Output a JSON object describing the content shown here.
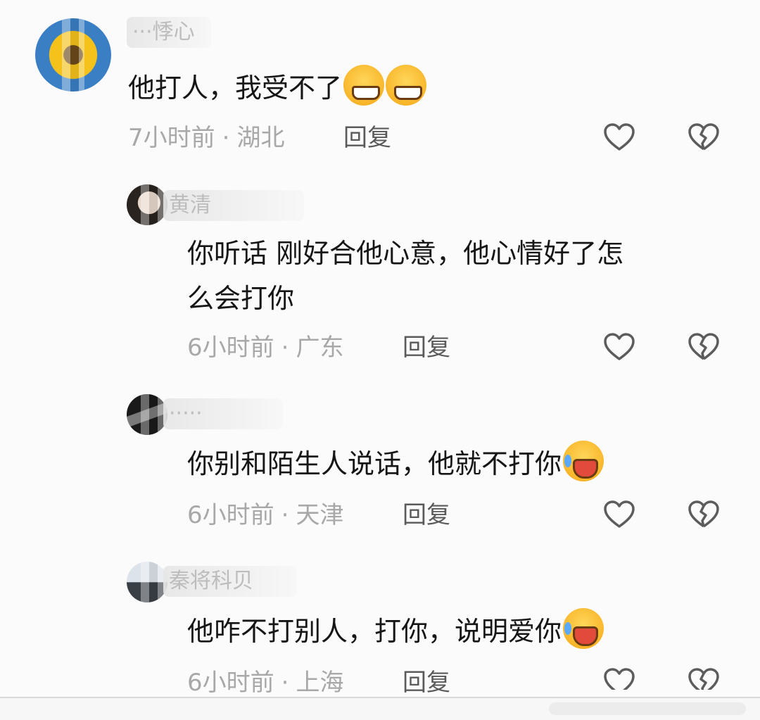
{
  "comments": [
    {
      "username": "···悸心",
      "text": "他打人，我受不了",
      "emoji": [
        "grin-sweat-icon",
        "grin-sweat-icon"
      ],
      "time": "7小时前",
      "region": "湖北",
      "reply_label": "回复"
    },
    {
      "username": "黄清",
      "text_line1": "你听话 刚好合他心意，他心情好了怎",
      "text_line2": "么会打你",
      "time": "6小时前",
      "region": "广东",
      "reply_label": "回复"
    },
    {
      "username": "·····",
      "text": "你别和陌生人说话，他就不打你",
      "emoji": [
        "laugh-cry-icon"
      ],
      "time": "6小时前",
      "region": "天津",
      "reply_label": "回复"
    },
    {
      "username": "秦将科贝",
      "text": "他咋不打别人，打你，说明爱你",
      "emoji": [
        "laugh-cry-icon"
      ],
      "time": "6小时前",
      "region": "上海",
      "reply_label": "回复"
    }
  ],
  "separator": "·",
  "colors": {
    "background": "#fbfbfb",
    "text": "#161616",
    "meta": "#a8a8a8",
    "reply": "#5a5a5a",
    "icon": "#5c5c5c"
  },
  "icons": [
    "heart-outline-icon",
    "broken-heart-icon"
  ]
}
